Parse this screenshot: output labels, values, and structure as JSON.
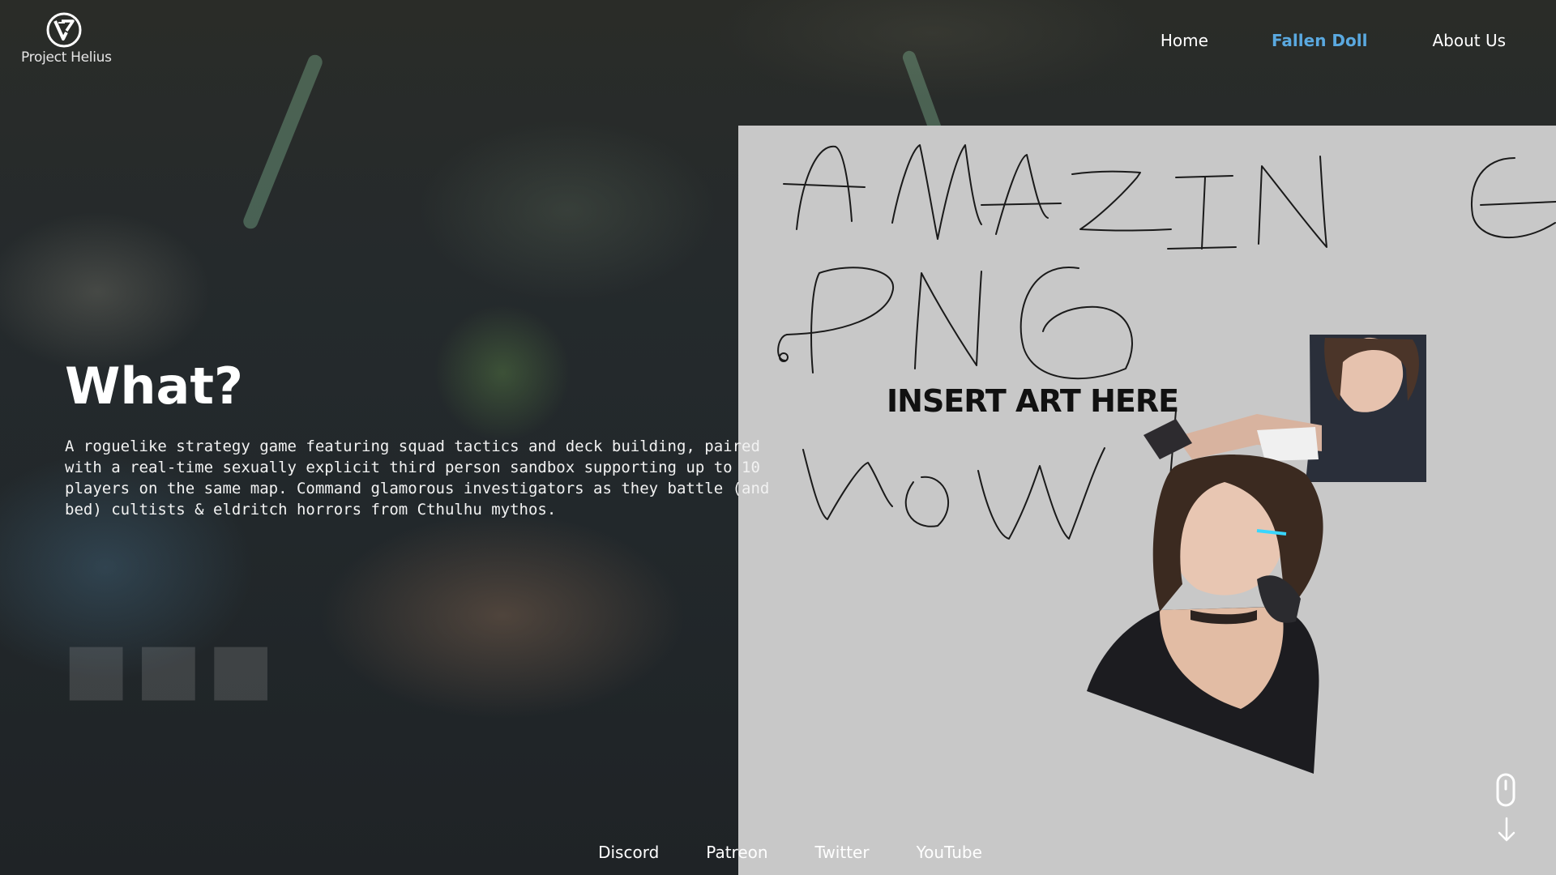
{
  "brand": {
    "name": "Project Helius",
    "logo_icon": "helius-emblem-icon"
  },
  "nav": {
    "items": [
      {
        "label": "Home",
        "active": false
      },
      {
        "label": "Fallen Doll",
        "active": true
      },
      {
        "label": "About Us",
        "active": false
      }
    ]
  },
  "hero": {
    "title": "What?",
    "description": "A roguelike strategy game featuring squad tactics and deck building, paired\nwith a real-time sexually explicit third person sandbox supporting up to 10\nplayers on the same map. Command glamorous investigators as they battle (and\nbed) cultists & eldritch horrors from Cthulhu mythos."
  },
  "art_panel": {
    "sketch_lines": [
      "AMAZING",
      "PNG",
      "WOW!"
    ],
    "label": "INSERT ART HERE",
    "image": "character-artwork-placeholder"
  },
  "footer": {
    "links": [
      "Discord",
      "Patreon",
      "Twitter",
      "YouTube"
    ]
  },
  "scroll_hint": {
    "icons": [
      "mouse-icon",
      "arrow-down-icon"
    ]
  },
  "colors": {
    "accent": "#5aa9e0",
    "panel_bg": "#c8c8c8",
    "text": "#ffffff"
  }
}
